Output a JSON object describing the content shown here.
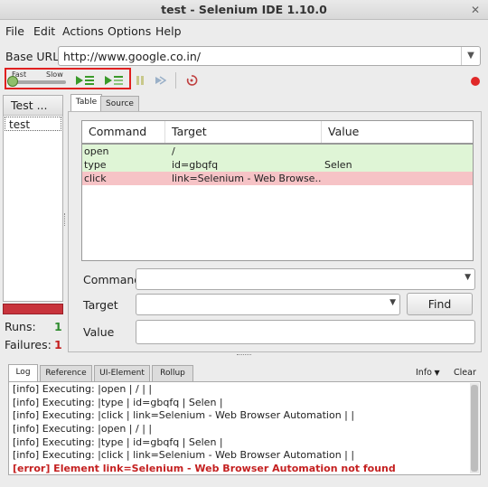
{
  "window": {
    "title": "test - Selenium IDE 1.10.0"
  },
  "menu": [
    "File",
    "Edit",
    "Actions",
    "Options",
    "Help"
  ],
  "base_url": {
    "label": "Base URL",
    "value": "http://www.google.co.in/"
  },
  "speed": {
    "fast_label": "Fast",
    "slow_label": "Slow",
    "level": 0.0
  },
  "test_panel": {
    "header": "Test ...",
    "items": [
      "test"
    ]
  },
  "counts": {
    "runs_label": "Runs:",
    "runs_value": "1",
    "failures_label": "Failures:",
    "failures_value": "1",
    "runs_color": "#2e8b2e",
    "failures_color": "#c42020"
  },
  "tabs": [
    "Table",
    "Source"
  ],
  "grid": {
    "headers": [
      "Command",
      "Target",
      "Value"
    ],
    "rows": [
      {
        "command": "open",
        "target": "/",
        "value": "",
        "status": "ok"
      },
      {
        "command": "type",
        "target": "id=gbqfq",
        "value": "Selen",
        "status": "ok"
      },
      {
        "command": "click",
        "target": "link=Selenium - Web Browse...",
        "value": "",
        "status": "fail"
      }
    ]
  },
  "editor": {
    "command_label": "Command",
    "target_label": "Target",
    "value_label": "Value",
    "find_button": "Find",
    "command_value": "",
    "target_value": "",
    "value_value": ""
  },
  "log_tabs": [
    "Log",
    "Reference",
    "UI-Element",
    "Rollup"
  ],
  "log_controls": {
    "info": "Info",
    "clear": "Clear"
  },
  "log_lines": [
    {
      "text": "[info] Executing: |open | / | |",
      "level": "info"
    },
    {
      "text": "[info] Executing: |type | id=gbqfq | Selen |",
      "level": "info"
    },
    {
      "text": "[info] Executing: |click | link=Selenium - Web Browser Automation | |",
      "level": "info"
    },
    {
      "text": "[info] Executing: |open | / | |",
      "level": "info"
    },
    {
      "text": "[info] Executing: |type | id=gbqfq | Selen |",
      "level": "info"
    },
    {
      "text": "[info] Executing: |click | link=Selenium - Web Browser Automation | |",
      "level": "info"
    },
    {
      "text": "[error] Element link=Selenium - Web Browser Automation not found",
      "level": "error"
    }
  ],
  "colors": {
    "pass_row": "#dff5d6",
    "fail_row": "#f6c3c6",
    "highlight_border": "#e02020"
  }
}
